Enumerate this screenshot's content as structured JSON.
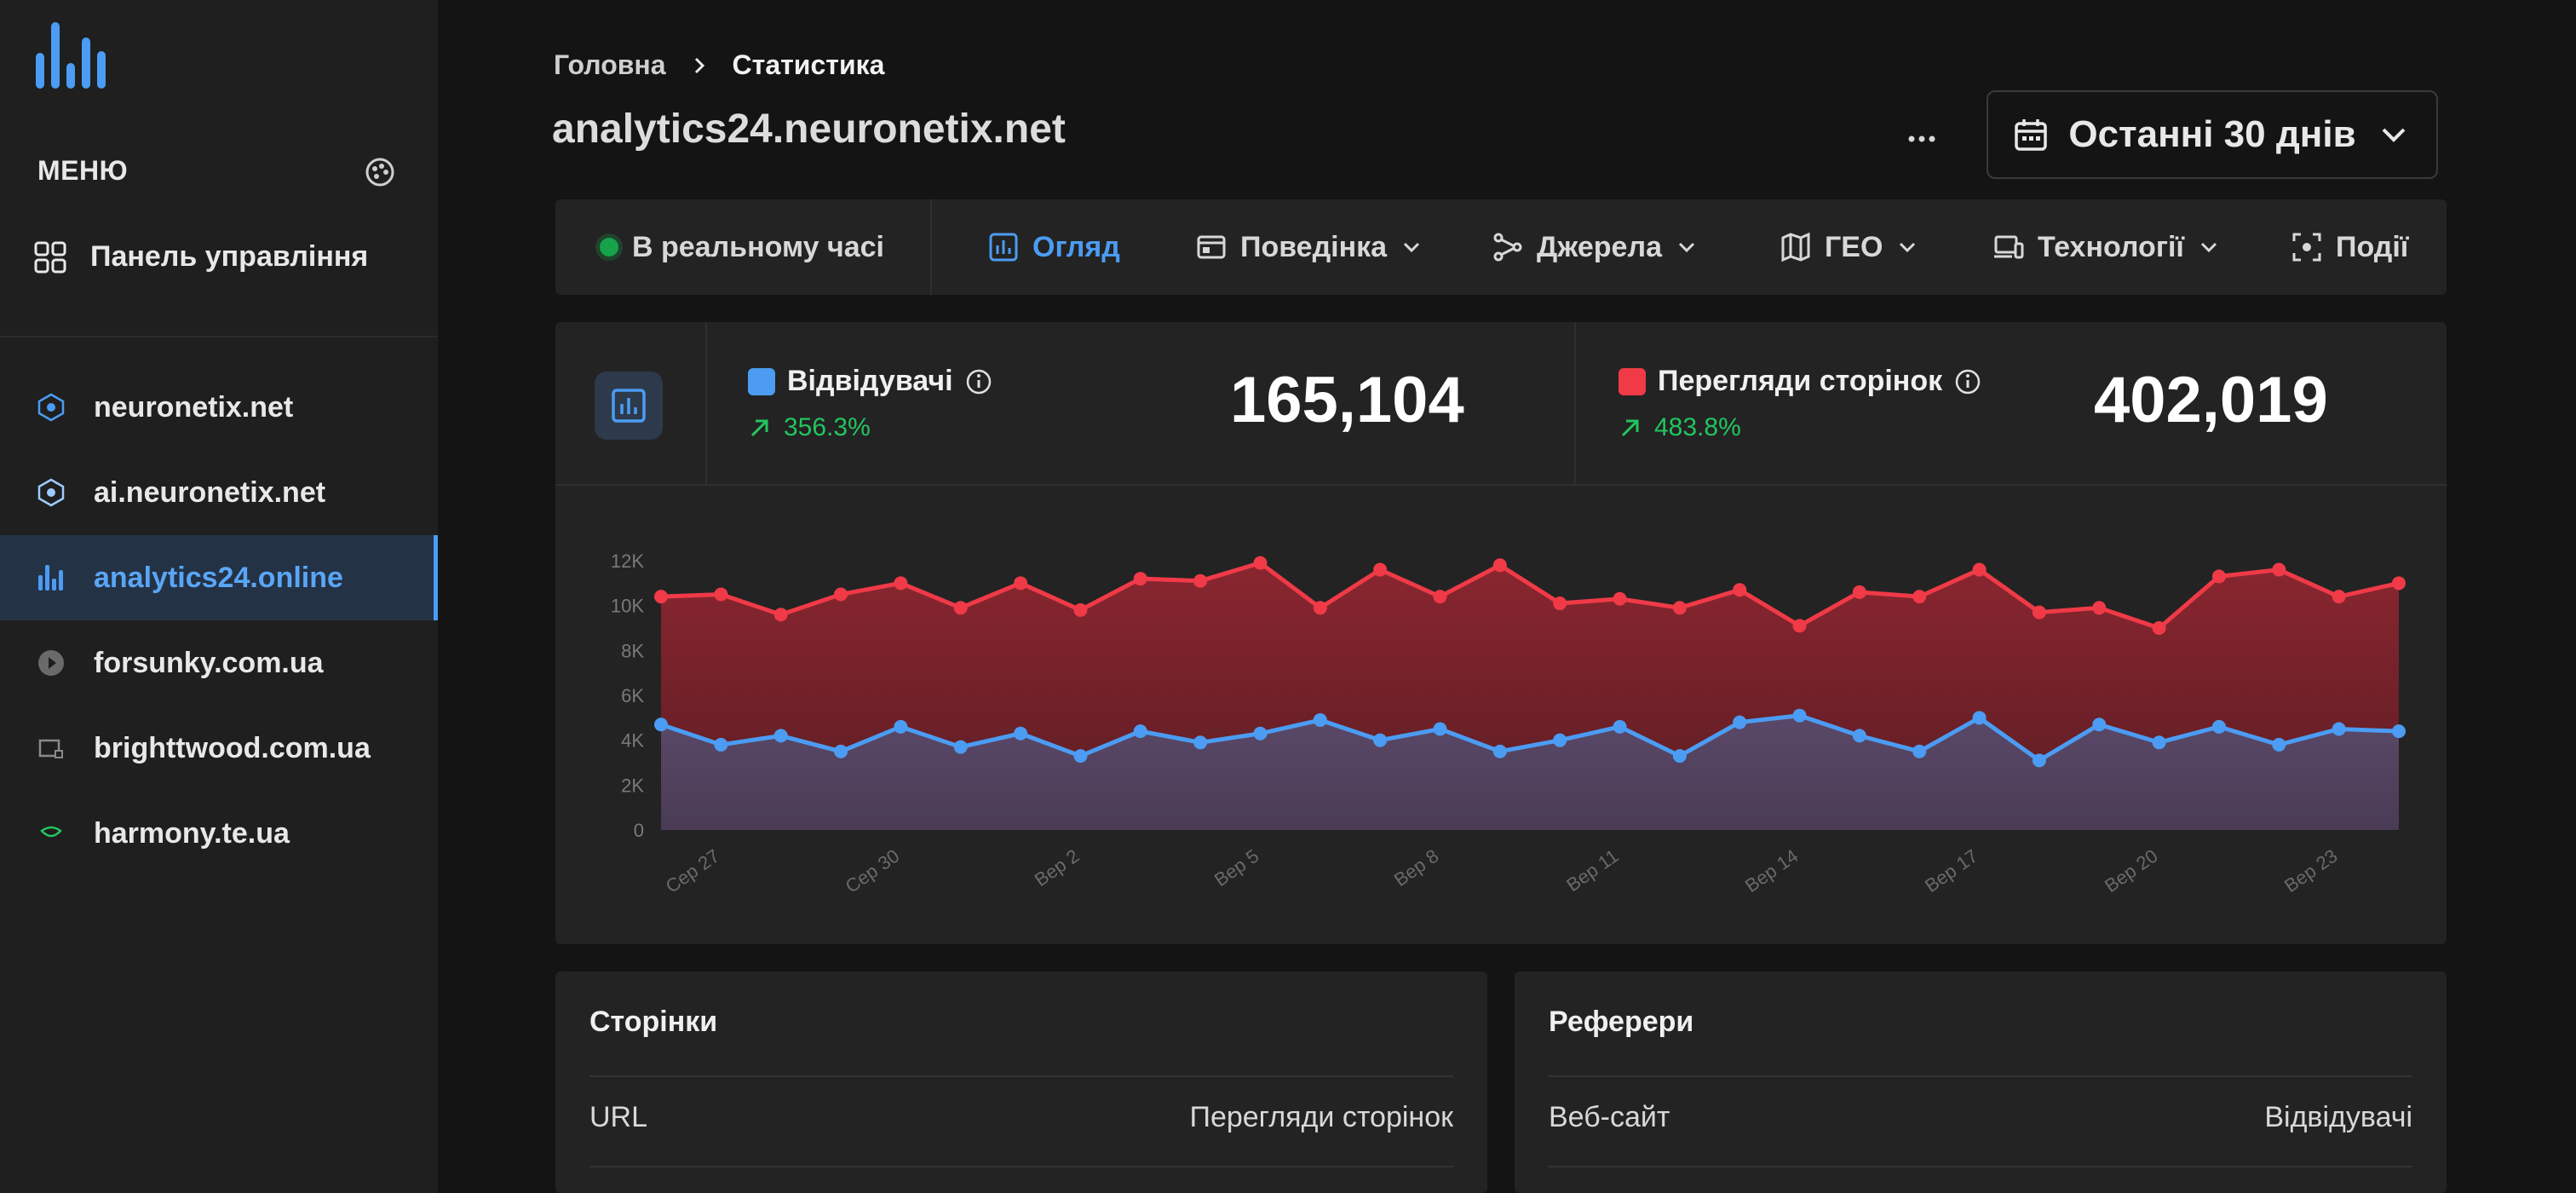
{
  "sidebar": {
    "menu_label": "МЕНЮ",
    "dashboard_label": "Панель управління",
    "sites": [
      {
        "label": "neuronetix.net",
        "icon": "neuronetix-logo-icon"
      },
      {
        "label": "ai.neuronetix.net",
        "icon": "neuronetix-logo-icon"
      },
      {
        "label": "analytics24.online",
        "icon": "bar-chart-icon",
        "active": true
      },
      {
        "label": "forsunky.com.ua",
        "icon": "play-circle-icon"
      },
      {
        "label": "brighttwood.com.ua",
        "icon": "brighttwood-logo-icon"
      },
      {
        "label": "harmony.te.ua",
        "icon": "harmony-logo-icon"
      }
    ]
  },
  "header": {
    "breadcrumb_home": "Головна",
    "breadcrumb_current": "Статистика",
    "title": "analytics24.neuronetix.net",
    "date_range": "Останні 30 днів"
  },
  "tabs": [
    {
      "label": "В реальному часі",
      "icon": "live-dot"
    },
    {
      "label": "Огляд",
      "icon": "bar-chart-icon",
      "active": true
    },
    {
      "label": "Поведінка",
      "icon": "window-icon",
      "dropdown": true
    },
    {
      "label": "Джерела",
      "icon": "share-nodes-icon",
      "dropdown": true
    },
    {
      "label": "ГЕО",
      "icon": "map-icon",
      "dropdown": true
    },
    {
      "label": "Технології",
      "icon": "devices-icon",
      "dropdown": true
    },
    {
      "label": "Події",
      "icon": "focus-icon"
    }
  ],
  "metrics": {
    "visitors": {
      "label": "Відвідувачі",
      "change": "356.3%",
      "value": "165,104",
      "color": "#4b9cf2"
    },
    "pageviews": {
      "label": "Перегляди сторінок",
      "change": "483.8%",
      "value": "402,019",
      "color": "#f03a47"
    }
  },
  "chart_data": {
    "type": "area",
    "title": "",
    "xlabel": "",
    "ylabel": "",
    "ylim": [
      0,
      12000
    ],
    "yticks": [
      "0",
      "2K",
      "4K",
      "6K",
      "8K",
      "10K",
      "12K"
    ],
    "xtick_labels": [
      "Сер 27",
      "Сер 30",
      "Вер 2",
      "Вер 5",
      "Вер 8",
      "Вер 11",
      "Вер 14",
      "Вер 17",
      "Вер 20",
      "Вер 23"
    ],
    "x": [
      "Сер 26",
      "Сер 27",
      "Сер 28",
      "Сер 29",
      "Сер 30",
      "Сер 31",
      "Вер 1",
      "Вер 2",
      "Вер 3",
      "Вер 4",
      "Вер 5",
      "Вер 6",
      "Вер 7",
      "Вер 8",
      "Вер 9",
      "Вер 10",
      "Вер 11",
      "Вер 12",
      "Вер 13",
      "Вер 14",
      "Вер 15",
      "Вер 16",
      "Вер 17",
      "Вер 18",
      "Вер 19",
      "Вер 20",
      "Вер 21",
      "Вер 22",
      "Вер 23",
      "Вер 24"
    ],
    "series": [
      {
        "name": "Перегляди сторінок",
        "color": "#f03a47",
        "values": [
          10400,
          10500,
          9600,
          10500,
          11000,
          9900,
          11000,
          9800,
          11200,
          11100,
          11900,
          9900,
          11600,
          10400,
          11800,
          10100,
          10300,
          9900,
          10700,
          9100,
          10600,
          10400,
          11600,
          9700,
          9900,
          9000,
          11300,
          11600,
          10400,
          11000
        ]
      },
      {
        "name": "Відвідувачі",
        "color": "#4b9cf2",
        "values": [
          4700,
          3800,
          4200,
          3500,
          4600,
          3700,
          4300,
          3300,
          4400,
          3900,
          4300,
          4900,
          4000,
          4500,
          3500,
          4000,
          4600,
          3300,
          4800,
          5100,
          4200,
          3500,
          5000,
          3100,
          4700,
          3900,
          4600,
          3800,
          4500,
          4400
        ]
      }
    ],
    "grid": false,
    "legend": "none"
  },
  "pages_card": {
    "title": "Сторінки",
    "col_left": "URL",
    "col_right": "Перегляди сторінок"
  },
  "referrers_card": {
    "title": "Реферери",
    "col_left": "Веб-сайт",
    "col_right": "Відвідувачі"
  }
}
